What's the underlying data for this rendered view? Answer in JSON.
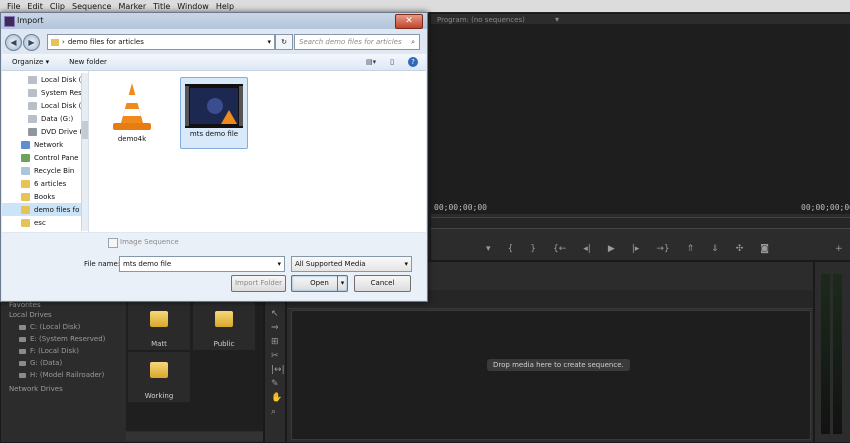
{
  "menubar": {
    "items": [
      "File",
      "Edit",
      "Clip",
      "Sequence",
      "Marker",
      "Title",
      "Window",
      "Help"
    ]
  },
  "program_monitor": {
    "tab_label": "Program: (no sequences)",
    "timecode_left": "00;00;00;00",
    "timecode_right": "00;00;00;00"
  },
  "timeline": {
    "drop_hint": "Drop media here to create sequence."
  },
  "media_browser": {
    "favorites_label": "Favorites",
    "local_drives_label": "Local Drives",
    "drives": [
      "C: (Local Disk)",
      "E: (System Reserved)",
      "F: (Local Disk)",
      "G: (Data)",
      "H: (Model Railroader)"
    ],
    "network_drives_label": "Network Drives",
    "folders": [
      "Matt",
      "Public",
      "Working"
    ]
  },
  "dialog": {
    "title": "Import",
    "close_label": "✕",
    "address": "demo files for articles",
    "search_placeholder": "Search demo files for articles",
    "organize_label": "Organize ▾",
    "new_folder_label": "New folder",
    "nav_items": [
      "Local Disk (",
      "System Res",
      "Local Disk (",
      "Data (G:)",
      "DVD Drive (",
      "Network",
      "Control Pane",
      "Recycle Bin",
      "6 articles",
      "Books",
      "demo files fo",
      "esc"
    ],
    "files": [
      {
        "name": "demo4k",
        "icon": "vlc-cone-icon"
      },
      {
        "name": "mts demo file",
        "icon": "video-thumbnail-icon"
      }
    ],
    "image_sequence_label": "Image Sequence",
    "file_name_label": "File name:",
    "file_name_value": "mts demo file",
    "file_type_value": "All Supported Media",
    "import_folder_label": "Import Folder",
    "open_label": "Open",
    "cancel_label": "Cancel"
  },
  "colors": {
    "dialog_bg": "#dfe8f2",
    "premiere_bg": "#232323",
    "selection": "#cce4f7"
  }
}
